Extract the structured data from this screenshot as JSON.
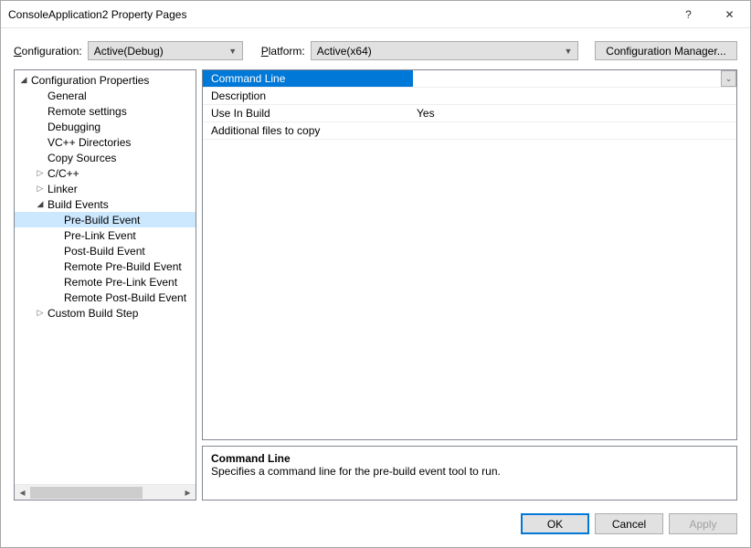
{
  "window": {
    "title": "ConsoleApplication2 Property Pages",
    "help": "?",
    "close": "✕"
  },
  "cfg": {
    "configLabelPre": "C",
    "configLabelRest": "onfiguration:",
    "configValue": "Active(Debug)",
    "platformLabelPre": "P",
    "platformLabelRest": "latform:",
    "platformValue": "Active(x64)",
    "manager": "Configuration Manager..."
  },
  "tree": [
    {
      "depth": 0,
      "exp": "open",
      "label": "Configuration Properties"
    },
    {
      "depth": 1,
      "exp": "",
      "label": "General"
    },
    {
      "depth": 1,
      "exp": "",
      "label": "Remote settings"
    },
    {
      "depth": 1,
      "exp": "",
      "label": "Debugging"
    },
    {
      "depth": 1,
      "exp": "",
      "label": "VC++ Directories"
    },
    {
      "depth": 1,
      "exp": "",
      "label": "Copy Sources"
    },
    {
      "depth": 1,
      "exp": "closed",
      "label": "C/C++"
    },
    {
      "depth": 1,
      "exp": "closed",
      "label": "Linker"
    },
    {
      "depth": 1,
      "exp": "open",
      "label": "Build Events"
    },
    {
      "depth": 2,
      "exp": "",
      "label": "Pre-Build Event",
      "sel": true
    },
    {
      "depth": 2,
      "exp": "",
      "label": "Pre-Link Event"
    },
    {
      "depth": 2,
      "exp": "",
      "label": "Post-Build Event"
    },
    {
      "depth": 2,
      "exp": "",
      "label": "Remote Pre-Build Event"
    },
    {
      "depth": 2,
      "exp": "",
      "label": "Remote Pre-Link Event"
    },
    {
      "depth": 2,
      "exp": "",
      "label": "Remote Post-Build Event"
    },
    {
      "depth": 1,
      "exp": "closed",
      "label": "Custom Build Step"
    }
  ],
  "grid": [
    {
      "name": "Command Line",
      "value": "",
      "sel": true,
      "drop": true
    },
    {
      "name": "Description",
      "value": ""
    },
    {
      "name": "Use In Build",
      "value": "Yes"
    },
    {
      "name": "Additional files to copy",
      "value": ""
    }
  ],
  "desc": {
    "title": "Command Line",
    "text": "Specifies a command line for the pre-build event tool to run."
  },
  "footer": {
    "ok": "OK",
    "cancel": "Cancel",
    "apply": "Apply"
  }
}
